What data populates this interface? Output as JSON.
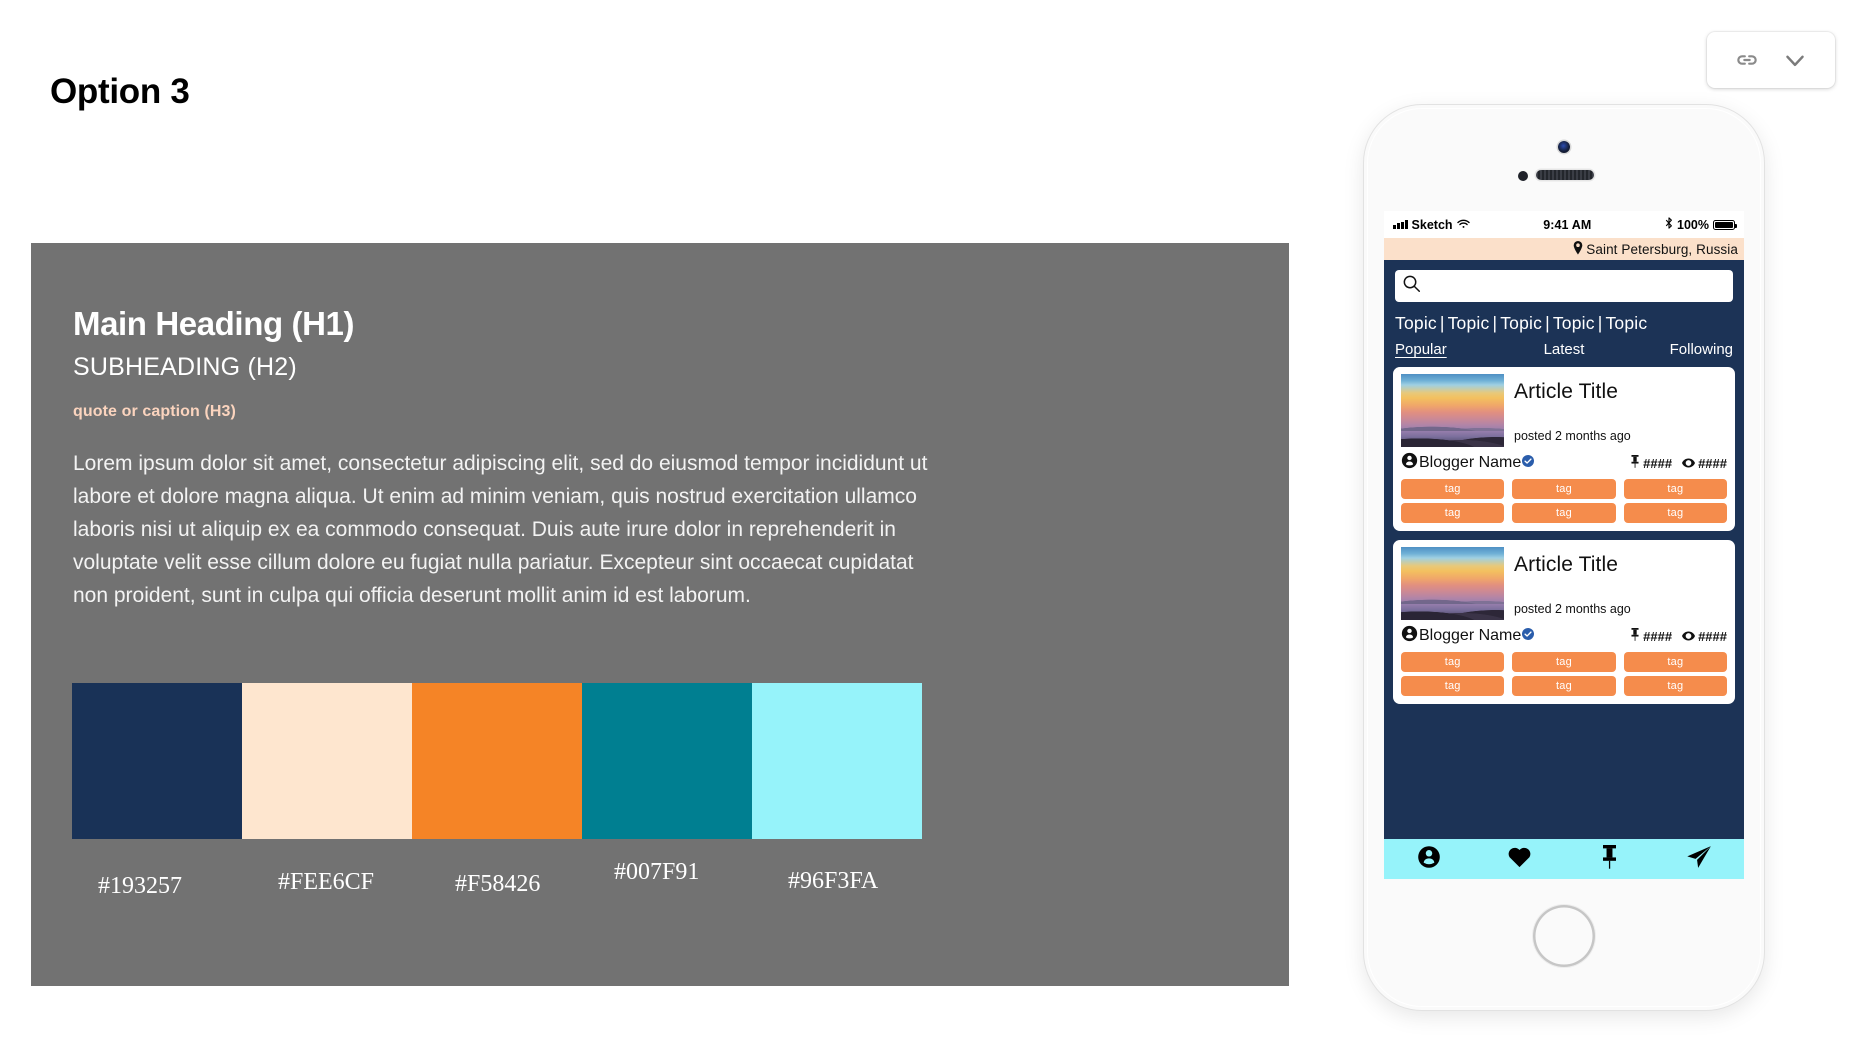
{
  "page": {
    "title": "Option 3",
    "background": "#ffffff"
  },
  "link_control": {
    "link_icon": "link-icon",
    "chevron_icon": "chevron-down-icon"
  },
  "style_panel": {
    "background": "#727272",
    "h1": "Main Heading (H1)",
    "h2": "SUBHEADING (H2)",
    "h3": "quote or caption (H3)",
    "h3_color": "#FBD4BE",
    "body": "Lorem ipsum dolor sit amet, consectetur adipiscing elit, sed do eiusmod tempor incididunt ut labore et dolore magna aliqua. Ut enim ad minim veniam, quis nostrud exercitation ullamco laboris nisi ut aliquip ex ea commodo consequat. Duis aute irure dolor in reprehenderit in voluptate velit esse cillum dolore eu fugiat nulla pariatur. Excepteur sint occaecat cupidatat non proident, sunt in culpa qui officia deserunt mollit anim id est laborum.",
    "swatches": [
      {
        "hex": "#193257",
        "label": "#193257"
      },
      {
        "hex": "#FEE6CF",
        "label": "#FEE6CF"
      },
      {
        "hex": "#F58426",
        "label": "#F58426"
      },
      {
        "hex": "#007F91",
        "label": "#007F91"
      },
      {
        "hex": "#96F3FA",
        "label": "#96F3FA"
      }
    ]
  },
  "phone": {
    "status_bar": {
      "carrier": "Sketch",
      "wifi_icon": "wifi-icon",
      "time": "9:41 AM",
      "bluetooth_icon": "bluetooth-icon",
      "battery_percent": "100%",
      "battery_icon": "battery-full-icon"
    },
    "location_bar": {
      "pin_icon": "map-pin-icon",
      "text": "Saint Petersburg, Russia",
      "background": "#FBE0CA"
    },
    "search": {
      "icon": "search-icon",
      "value": "",
      "placeholder": ""
    },
    "topics": [
      "Topic",
      "Topic",
      "Topic",
      "Topic",
      "Topic"
    ],
    "topic_separator": "|",
    "tabs": [
      {
        "label": "Popular",
        "active": true
      },
      {
        "label": "Latest",
        "active": false
      },
      {
        "label": "Following",
        "active": false
      }
    ],
    "cards": [
      {
        "thumbnail": "sunset-mountains-photo",
        "title": "Article Title",
        "posted": "posted 2 months ago",
        "author": "Blogger Name",
        "author_icon": "user-circle-icon",
        "verified_icon": "verified-badge-icon",
        "stats": [
          {
            "icon": "pushpin-icon",
            "value": "####"
          },
          {
            "icon": "eye-icon",
            "value": "####"
          }
        ],
        "tags": [
          "tag",
          "tag",
          "tag",
          "tag",
          "tag",
          "tag"
        ]
      },
      {
        "thumbnail": "sunset-mountains-photo",
        "title": "Article Title",
        "posted": "posted 2 months ago",
        "author": "Blogger Name",
        "author_icon": "user-circle-icon",
        "verified_icon": "verified-badge-icon",
        "stats": [
          {
            "icon": "pushpin-icon",
            "value": "####"
          },
          {
            "icon": "eye-icon",
            "value": "####"
          }
        ],
        "tags": [
          "tag",
          "tag",
          "tag",
          "tag",
          "tag",
          "tag"
        ]
      }
    ],
    "bottom_nav": {
      "background": "#96F3FA",
      "items": [
        {
          "icon": "profile-icon"
        },
        {
          "icon": "heart-icon"
        },
        {
          "icon": "pushpin-icon"
        },
        {
          "icon": "send-icon"
        }
      ]
    },
    "screen_background": "#1c3356",
    "tag_color": "#F58C4C"
  }
}
